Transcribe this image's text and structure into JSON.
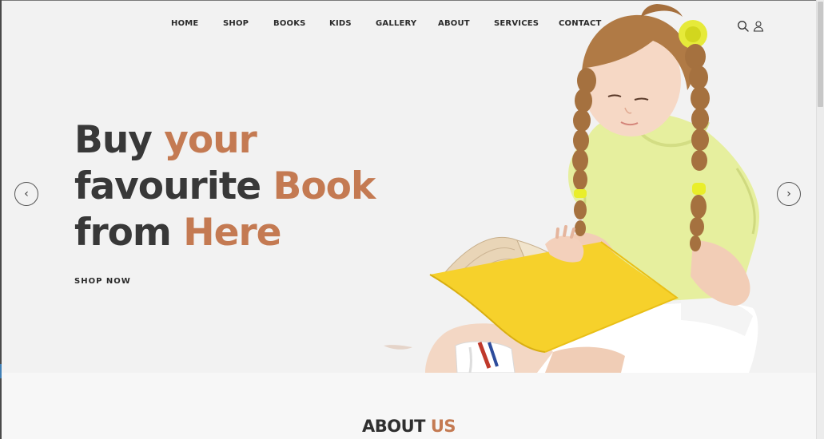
{
  "nav": {
    "items": [
      {
        "label": "HOME"
      },
      {
        "label": "SHOP"
      },
      {
        "label": "BOOKS"
      },
      {
        "label": "KIDS"
      },
      {
        "label": "GALLERY"
      },
      {
        "label": "ABOUT"
      },
      {
        "label": "SERVICES"
      },
      {
        "label": "CONTACT"
      }
    ],
    "icons": [
      "search-icon",
      "user-icon"
    ]
  },
  "hero": {
    "line1": {
      "plain": "Buy ",
      "accent": "your"
    },
    "line2": {
      "plain": "favourite ",
      "accent": "Book"
    },
    "line3": {
      "plain": "from ",
      "accent": "Here"
    },
    "cta": "SHOP NOW",
    "prev_arrow": "‹",
    "next_arrow": "›"
  },
  "about": {
    "title_plain": "ABOUT ",
    "title_accent": "US"
  },
  "colors": {
    "accent": "#c47a52",
    "heading": "#383838",
    "background": "#f2f2f2"
  }
}
